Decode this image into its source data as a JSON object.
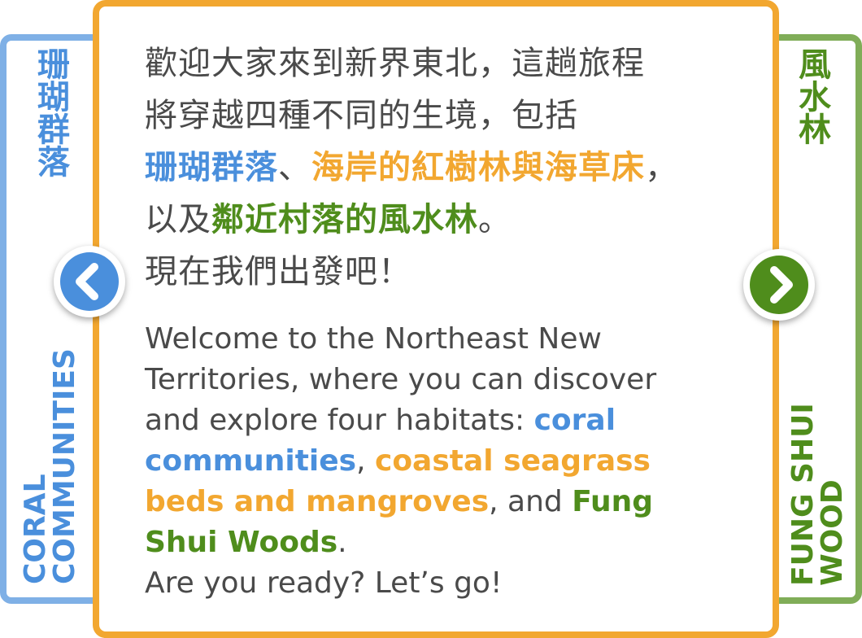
{
  "left_panel": {
    "title_zh": "珊瑚群落",
    "title_en_line1": "CORAL",
    "title_en_line2": "COMMUNITIES",
    "color": "#4a8fdc"
  },
  "right_panel": {
    "title_zh": "風水林",
    "title_en_line1": "FUNG SHUI",
    "title_en_line2": "WOOD",
    "color": "#4f8d1c"
  },
  "main_panel": {
    "border_color": "#f2a730",
    "zh": {
      "line1": "歡迎大家來到新界東北，這趟旅程",
      "line2": "將穿越四種不同的生境，包括",
      "coral": "珊瑚群落",
      "sep1": "、",
      "mangrove": "海岸的紅樹林與海草床",
      "sep2": "，",
      "line4_pre": "以及",
      "fungshui": "鄰近村落的風水林",
      "line4_post": "。",
      "line5": "現在我們出發吧！"
    },
    "en": {
      "line1": "Welcome to the Northeast New",
      "line2": "Territories, where you can discover",
      "line3_pre": "and explore four habitats: ",
      "coral_a": "coral",
      "coral_b": "communities",
      "sep1": ", ",
      "seagrass_a": "coastal seagrass",
      "seagrass_b": "beds and mangroves",
      "sep2": ", and ",
      "fungshui_a": "Fung",
      "fungshui_b": "Shui Woods",
      "end": ".",
      "line7": "Are you ready? Let’s go!"
    }
  },
  "nav": {
    "prev_icon": "chevron-left-icon",
    "next_icon": "chevron-right-icon",
    "prev_color": "#4a8fdc",
    "next_color": "#4f8d1c"
  },
  "colors": {
    "coral": "#4a8fdc",
    "coastal": "#f2a730",
    "fungshui": "#4f8d1c",
    "text": "#4a4a4a"
  }
}
